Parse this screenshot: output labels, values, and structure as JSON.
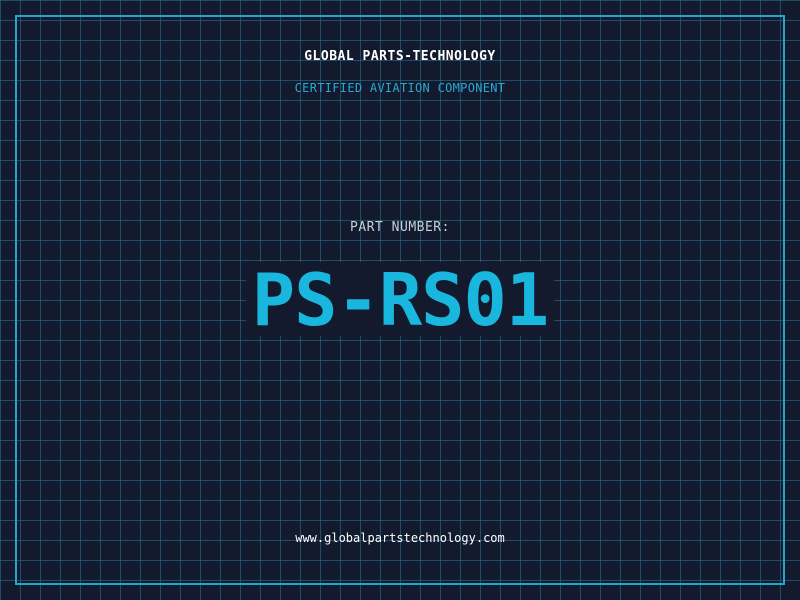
{
  "header": {
    "company_name": "GLOBAL PARTS-TECHNOLOGY",
    "subtitle": "CERTIFIED AVIATION COMPONENT"
  },
  "part": {
    "label": "PART NUMBER:",
    "number": "PS-RS01"
  },
  "footer": {
    "website": "www.globalpartstechnology.com"
  },
  "colors": {
    "background": "#131a2e",
    "grid": "#26788f",
    "accent": "#1fa6c9",
    "part_number": "#19b7dd",
    "text_primary": "#ffffff",
    "text_muted": "#c9ced9"
  }
}
